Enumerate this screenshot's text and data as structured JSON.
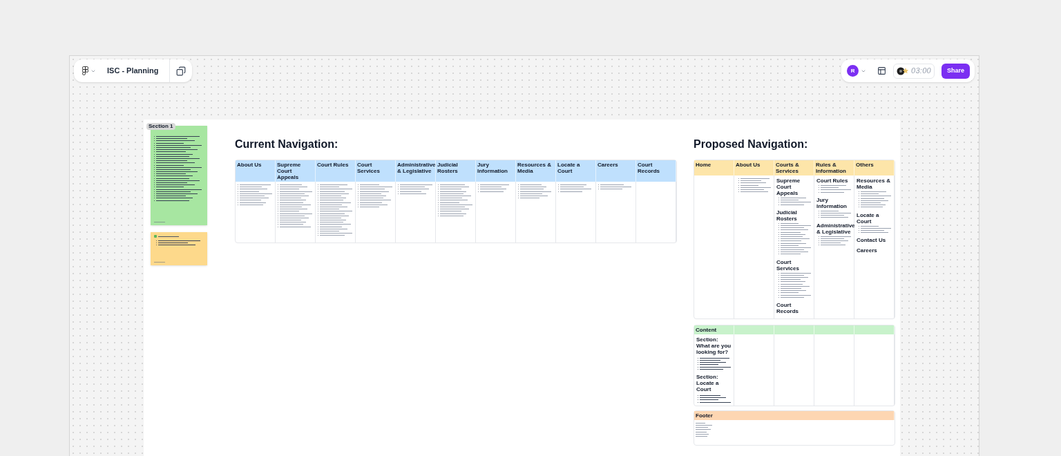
{
  "toolbar": {
    "file_name": "ISC - Planning",
    "avatar": "R",
    "timer": "03:00",
    "share": "Share"
  },
  "section_label": "Section 1",
  "notes": [
    {
      "kind": "note",
      "color": "#a7e6a1"
    },
    {
      "kind": "note",
      "color": "#fdd98b"
    }
  ],
  "current_navigation": {
    "title": "Current Navigation:",
    "columns": [
      "About Us",
      "Supreme Court Appeals",
      "Court Rules",
      "Court Services",
      "Administrative & Legislative",
      "Judicial Rosters",
      "Jury Information",
      "Resources & Media",
      "Locate a Court",
      "Careers",
      "Court Records"
    ]
  },
  "proposed_navigation": {
    "title": "Proposed Navigation:",
    "columns": [
      {
        "label": "Home"
      },
      {
        "label": "About Us",
        "groups": [
          {
            "kind": "list"
          }
        ]
      },
      {
        "label": "Courts & Services",
        "groups": [
          {
            "kind": "section",
            "heading": "Supreme Court Appeals"
          },
          {
            "kind": "section",
            "heading": "Judicial Rosters"
          },
          {
            "kind": "section",
            "heading": "Court Services"
          },
          {
            "kind": "section",
            "heading": "Court Records"
          }
        ]
      },
      {
        "label": "Rules & Information",
        "groups": [
          {
            "kind": "section",
            "heading": "Court Rules"
          },
          {
            "kind": "section",
            "heading": "Jury Information"
          },
          {
            "kind": "section",
            "heading": "Administrative & Legislative"
          }
        ]
      },
      {
        "label": "Others",
        "groups": [
          {
            "kind": "section",
            "heading": "Resources & Media"
          },
          {
            "kind": "section",
            "heading": "Locate a Court"
          },
          {
            "kind": "section",
            "heading": "Contact Us"
          },
          {
            "kind": "section",
            "heading": "Careers"
          }
        ]
      }
    ]
  },
  "content": {
    "header": "Content",
    "sections": [
      "Section: What are you looking for?",
      "Section: Locate a Court"
    ]
  },
  "footer": {
    "header": "Footer"
  }
}
